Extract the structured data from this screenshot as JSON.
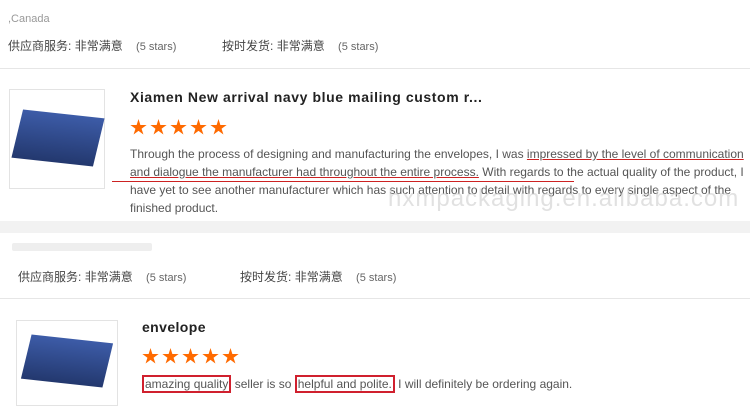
{
  "review1": {
    "country": ",Canada",
    "supplier_service_label": "供应商服务:",
    "supplier_service_value": "非常满意",
    "supplier_service_stars": "(5 stars)",
    "shipping_label": "按时发货:",
    "shipping_value": "非常满意",
    "shipping_stars": "(5 stars)"
  },
  "product1": {
    "title": "Xiamen New arrival navy blue mailing custom r...",
    "rating": 5,
    "review_parts": [
      "Through the process of designing and manufacturing the envelopes, I was ",
      "impressed by the level of communication and dialogue the manufacturer had throughout the entire process.",
      " With regards to the actual quality of the product, I have yet to see another manufacturer which has such attention to detail with regards to every single aspect of the finished product."
    ]
  },
  "watermark": "hxmpackaging.en.alibaba.com",
  "review2": {
    "supplier_service_label": "供应商服务:",
    "supplier_service_value": "非常满意",
    "supplier_service_stars": "(5 stars)",
    "shipping_label": "按时发货:",
    "shipping_value": "非常满意",
    "shipping_stars": "(5 stars)"
  },
  "product2": {
    "title": "envelope",
    "rating": 5,
    "review_parts": [
      "amazing quality",
      " seller is so ",
      "helpful and polite.",
      " I will definitely be ordering again."
    ]
  },
  "colors": {
    "star": "#ff6a00",
    "highlight": "#d0202e",
    "envelope": "#2e4785"
  }
}
